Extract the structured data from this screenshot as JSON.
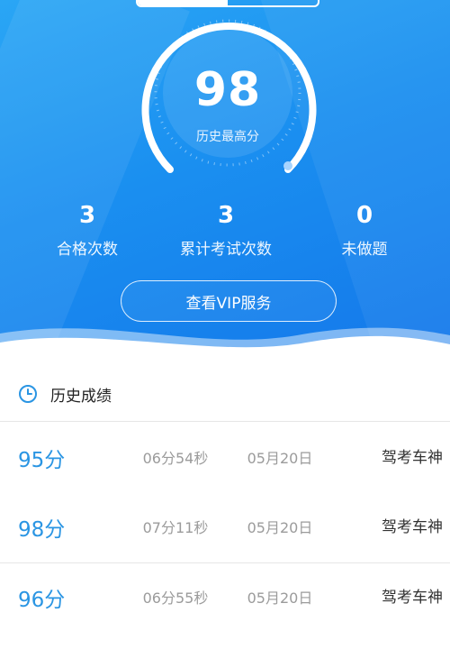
{
  "summary": {
    "best_score": "98",
    "best_score_label": "历史最高分",
    "stats": [
      {
        "value": "3",
        "label": "合格次数"
      },
      {
        "value": "3",
        "label": "累计考试次数"
      },
      {
        "value": "0",
        "label": "未做题"
      }
    ],
    "vip_button": "查看VIP服务"
  },
  "history": {
    "title": "历史成绩",
    "icon": "clock-icon",
    "rows": [
      {
        "score": "95分",
        "time": "06分54秒",
        "date": "05月20日",
        "source": "驾考车神"
      },
      {
        "score": "98分",
        "time": "07分11秒",
        "date": "05月20日",
        "source": "驾考车神"
      },
      {
        "score": "96分",
        "time": "06分55秒",
        "date": "05月20日",
        "source": "驾考车神"
      }
    ]
  },
  "colors": {
    "hero_start": "#2aa6f5",
    "hero_end": "#1478ea",
    "score_accent": "#2a95e3",
    "icon_accent": "#2a95e3"
  }
}
